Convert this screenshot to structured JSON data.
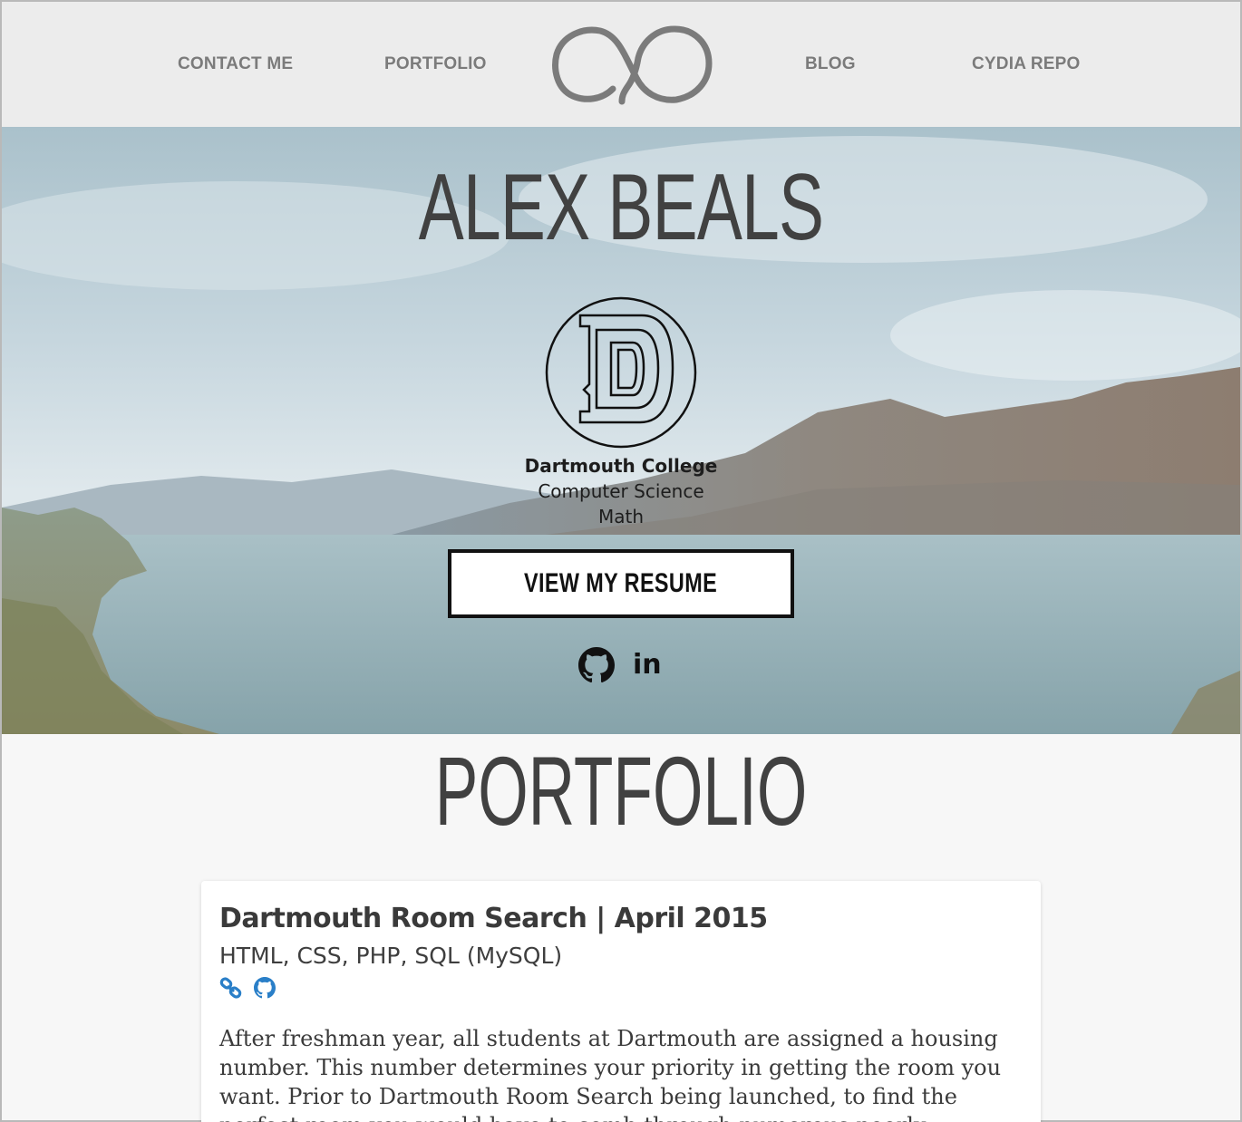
{
  "nav": {
    "items": [
      {
        "label": "CONTACT ME"
      },
      {
        "label": "PORTFOLIO"
      },
      {
        "label": "BLOG"
      },
      {
        "label": "CYDIA REPO"
      }
    ],
    "logo_icon": "infinity-logo-icon"
  },
  "hero": {
    "name": "ALEX BEALS",
    "seal_icon": "dartmouth-d-seal-icon",
    "school": "Dartmouth College",
    "majors": [
      "Computer Science",
      "Math"
    ],
    "resume_button": "VIEW MY RESUME",
    "social": [
      {
        "icon": "github-icon"
      },
      {
        "icon": "linkedin-icon",
        "label": "in"
      }
    ]
  },
  "portfolio": {
    "title": "PORTFOLIO",
    "projects": [
      {
        "title": "Dartmouth Room Search | April 2015",
        "tech": "HTML, CSS, PHP, SQL (MySQL)",
        "icons": [
          "link-icon",
          "github-icon"
        ],
        "description": "After freshman year, all students at Dartmouth are assigned a housing number. This number determines your priority in getting the room you want. Prior to Dartmouth Room Search being launched, to find the perfect room you would have to comb through numerous poorly formatted floor plans with unclear"
      }
    ]
  },
  "colors": {
    "nav_bg": "#ececec",
    "nav_text": "#7b7b7b",
    "heading": "#414141",
    "link_blue": "#2a7fc8"
  }
}
